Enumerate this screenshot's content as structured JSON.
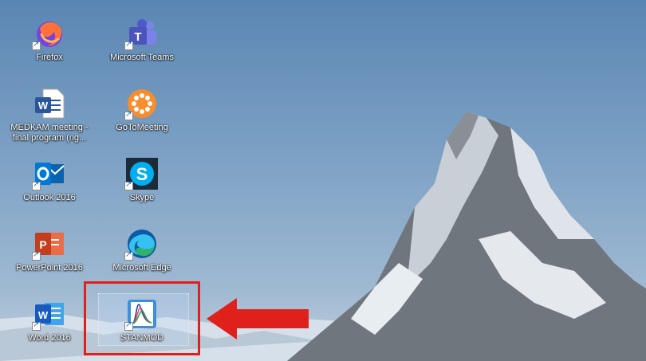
{
  "desktop": {
    "icons": [
      {
        "label": "Firefox",
        "icon": "firefox-icon"
      },
      {
        "label": "Microsoft Teams",
        "icon": "teams-icon"
      },
      {
        "label": "MEDKAM meeting - final program (ng...",
        "icon": "word-doc-icon"
      },
      {
        "label": "GoToMeeting",
        "icon": "gotomeeting-icon"
      },
      {
        "label": "Outlook 2016",
        "icon": "outlook-icon"
      },
      {
        "label": "Skype",
        "icon": "skype-icon"
      },
      {
        "label": "PowerPoint 2016",
        "icon": "powerpoint-icon"
      },
      {
        "label": "Microsoft Edge",
        "icon": "edge-icon"
      },
      {
        "label": "Word 2016",
        "icon": "word-icon"
      },
      {
        "label": "STANMOD",
        "icon": "stanmod-icon"
      }
    ]
  },
  "annotation": {
    "highlight_color": "#e0201a",
    "arrow_color": "#e0201a",
    "target": "STANMOD"
  }
}
